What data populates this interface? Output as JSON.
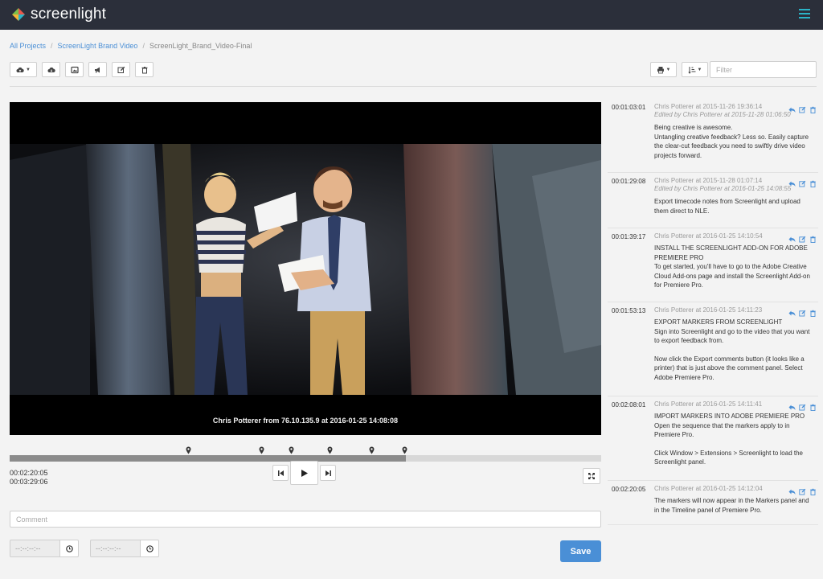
{
  "app": {
    "name": "screenlight"
  },
  "colors": {
    "topbar": "#2b2f3a",
    "accent": "#2bb3c6",
    "link": "#4a8fd6",
    "save": "#4a8fd6"
  },
  "breadcrumb": [
    {
      "label": "All Projects",
      "link": true
    },
    {
      "label": "ScreenLight Brand Video",
      "link": true
    },
    {
      "label": "ScreenLight_Brand_Video-Final",
      "link": false
    }
  ],
  "toolbar_left": [
    {
      "icon": "cloud-upload-icon",
      "dropdown": true
    },
    {
      "icon": "cloud-download-icon",
      "dropdown": false
    },
    {
      "icon": "image-icon",
      "dropdown": false
    },
    {
      "icon": "megaphone-icon",
      "dropdown": false
    },
    {
      "icon": "edit-icon",
      "dropdown": false
    },
    {
      "icon": "trash-icon",
      "dropdown": false
    }
  ],
  "toolbar_right": [
    {
      "icon": "print-icon",
      "dropdown": true
    },
    {
      "icon": "sort-icon",
      "dropdown": true
    }
  ],
  "filter": {
    "placeholder": "Filter",
    "value": ""
  },
  "video": {
    "overlay": "Chris Potterer from 76.10.135.9 at 2016-01-25 14:08:08",
    "current_time": "00:02:20:05",
    "duration": "00:03:29:06",
    "progress_fraction": 0.67,
    "marker_positions_fraction": [
      0.301,
      0.425,
      0.476,
      0.541,
      0.611,
      0.667
    ]
  },
  "comment_form": {
    "placeholder": "Comment",
    "in_placeholder": "--:--:--:--",
    "out_placeholder": "--:--:--:--",
    "save_label": "Save"
  },
  "comments": [
    {
      "timecode": "00:01:03:01",
      "meta": "Chris Potterer at 2015-11-26 19:36:14",
      "edited": "Edited by Chris Potterer at 2015-11-28 01:06:50",
      "body": [
        "Being creative is awesome.",
        "Untangling creative feedback? Less so. Easily capture the clear-cut feedback you need to swiftly drive video projects forward."
      ]
    },
    {
      "timecode": "00:01:29:08",
      "meta": "Chris Potterer at 2015-11-28 01:07:14",
      "edited": "Edited by Chris Potterer at 2016-01-25 14:08:55",
      "body": [
        "Export timecode notes from Screenlight and upload them direct to NLE."
      ]
    },
    {
      "timecode": "00:01:39:17",
      "meta": "Chris Potterer at 2016-01-25 14:10:54",
      "edited": "",
      "body": [
        "INSTALL THE SCREENLIGHT ADD-ON FOR ADOBE PREMIERE PRO",
        "To get started, you'll have to go to the Adobe Creative Cloud Add-ons page and install the Screenlight Add-on for Premiere Pro."
      ]
    },
    {
      "timecode": "00:01:53:13",
      "meta": "Chris Potterer at 2016-01-25 14:11:23",
      "edited": "",
      "body": [
        "EXPORT MARKERS FROM SCREENLIGHT",
        "Sign into Screenlight and go to the video that you want to export feedback from.",
        "Now click the Export comments button (it looks like a printer) that is just above the comment panel. Select Adobe Premiere Pro."
      ]
    },
    {
      "timecode": "00:02:08:01",
      "meta": "Chris Potterer at 2016-01-25 14:11:41",
      "edited": "",
      "body": [
        "IMPORT MARKERS INTO ADOBE PREMIERE PRO",
        "Open the sequence that the markers apply to in Premiere Pro.",
        "Click Window > Extensions > Screenlight to load the Screenlight panel."
      ]
    },
    {
      "timecode": "00:02:20:05",
      "meta": "Chris Potterer at 2016-01-25 14:12:04",
      "edited": "",
      "body": [
        "The markers will now appear in the Markers panel and in the Timeline panel of Premiere Pro."
      ]
    }
  ]
}
